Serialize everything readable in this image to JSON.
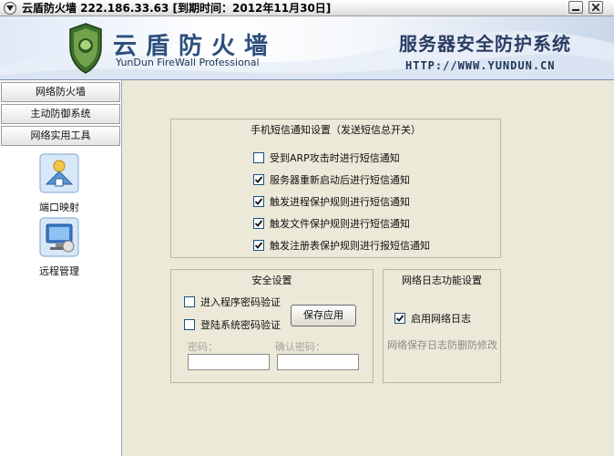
{
  "window": {
    "title": "云盾防火墙 222.186.33.63 [到期时间：2012年11月30日]"
  },
  "banner": {
    "brand_cn": "云盾防火墙",
    "brand_en": "YunDun FireWall Professional",
    "slogan": "服务器安全防护系统",
    "website": "HTTP://WWW.YUNDUN.CN"
  },
  "sidebar": {
    "nav": [
      {
        "label": "网络防火墙"
      },
      {
        "label": "主动防御系统"
      },
      {
        "label": "网络实用工具"
      }
    ],
    "tools": [
      {
        "label": "端口映射",
        "icon": "port-mapping-icon"
      },
      {
        "label": "远程管理",
        "icon": "remote-management-icon"
      }
    ]
  },
  "sms": {
    "title": "手机短信通知设置（发送短信总开关）",
    "options": [
      {
        "label": "受到ARP攻击时进行短信通知",
        "checked": false
      },
      {
        "label": "服务器重新启动后进行短信通知",
        "checked": true
      },
      {
        "label": "触发进程保护规则进行短信通知",
        "checked": true
      },
      {
        "label": "触发文件保护规则进行短信通知",
        "checked": true
      },
      {
        "label": "触发注册表保护规则进行报短信通知",
        "checked": true
      }
    ]
  },
  "security": {
    "title": "安全设置",
    "options": [
      {
        "label": "进入程序密码验证",
        "checked": false
      },
      {
        "label": "登陆系统密码验证",
        "checked": false
      }
    ],
    "save_label": "保存应用",
    "password_label": "密码：",
    "confirm_label": "确认密码：",
    "password_value": "",
    "confirm_value": ""
  },
  "log": {
    "title": "网络日志功能设置",
    "enable_label": "启用网络日志",
    "enable_checked": true,
    "info": "网络保存日志防删防修改"
  },
  "colors": {
    "accent": "#2d4f7c",
    "checkbox_border": "#1c5180"
  }
}
